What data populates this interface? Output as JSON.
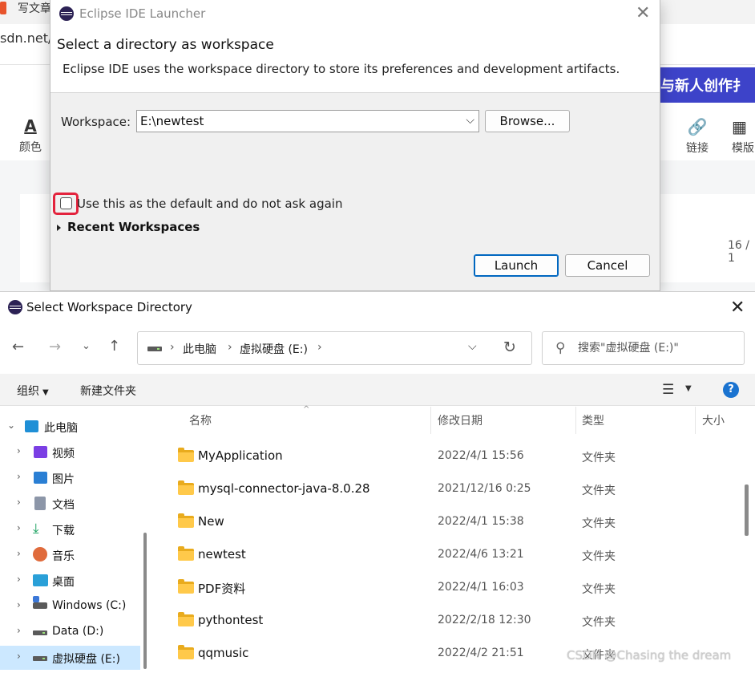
{
  "background": {
    "tab_text": "写文章",
    "url_fragment": "sdn.net/",
    "banner_text": "与新人创作扌",
    "toolbar": [
      {
        "label": "颜色",
        "glyph": "A"
      },
      {
        "label": "链接",
        "glyph": "🔗"
      },
      {
        "label": "模版",
        "glyph": "▦"
      }
    ],
    "page_counter": "16 / 1"
  },
  "launcher": {
    "title": "Eclipse IDE Launcher",
    "heading": "Select a directory as workspace",
    "description": "Eclipse IDE uses the workspace directory to store its preferences and development artifacts.",
    "workspace_label": "Workspace:",
    "workspace_value": "E:\\newtest",
    "browse_label": "Browse...",
    "default_checkbox_label": "Use this as the default and do not ask again",
    "default_checked": false,
    "recent_label": "Recent Workspaces",
    "launch_label": "Launch",
    "cancel_label": "Cancel"
  },
  "picker": {
    "title": "Select Workspace Directory",
    "breadcrumb": [
      "此电脑",
      "虚拟硬盘 (E:)"
    ],
    "search_placeholder": "搜索\"虚拟硬盘 (E:)\"",
    "command_bar": {
      "organize": "组织",
      "new_folder": "新建文件夹"
    },
    "tree": [
      {
        "label": "此电脑",
        "icon": "computer-icon",
        "color": "#1f8fd6",
        "expanded": true,
        "selected": false
      },
      {
        "label": "视频",
        "icon": "video-icon",
        "color": "#7b3fe4",
        "expanded": false,
        "selected": false
      },
      {
        "label": "图片",
        "icon": "pictures-icon",
        "color": "#2a7fd4",
        "expanded": false,
        "selected": false
      },
      {
        "label": "文档",
        "icon": "documents-icon",
        "color": "#8c96a8",
        "expanded": false,
        "selected": false
      },
      {
        "label": "下载",
        "icon": "download-icon",
        "color": "#1aa15f",
        "expanded": false,
        "selected": false
      },
      {
        "label": "音乐",
        "icon": "music-icon",
        "color": "#e06b3c",
        "expanded": false,
        "selected": false
      },
      {
        "label": "桌面",
        "icon": "desktop-icon",
        "color": "#2aa0d8",
        "expanded": false,
        "selected": false
      },
      {
        "label": "Windows (C:)",
        "icon": "windows-drive-icon",
        "color": "#3c78d8",
        "expanded": false,
        "selected": false
      },
      {
        "label": "Data (D:)",
        "icon": "drive-icon",
        "color": "#5a5a5a",
        "expanded": false,
        "selected": false
      },
      {
        "label": "虚拟硬盘 (E:)",
        "icon": "drive-icon",
        "color": "#5a5a5a",
        "expanded": false,
        "selected": true
      }
    ],
    "columns": [
      "名称",
      "修改日期",
      "类型",
      "大小"
    ],
    "files": [
      {
        "name": "MyApplication",
        "modified": "2022/4/1 15:56",
        "type": "文件夹"
      },
      {
        "name": "mysql-connector-java-8.0.28",
        "modified": "2021/12/16 0:25",
        "type": "文件夹"
      },
      {
        "name": "New",
        "modified": "2022/4/1 15:38",
        "type": "文件夹"
      },
      {
        "name": "newtest",
        "modified": "2022/4/6 13:21",
        "type": "文件夹"
      },
      {
        "name": "PDF资料",
        "modified": "2022/4/1 16:03",
        "type": "文件夹"
      },
      {
        "name": "pythontest",
        "modified": "2022/2/18 12:30",
        "type": "文件夹"
      },
      {
        "name": "qqmusic",
        "modified": "2022/4/2 21:51",
        "type": "文件夹"
      }
    ]
  },
  "watermark": "CSDN @Chasing the dream"
}
